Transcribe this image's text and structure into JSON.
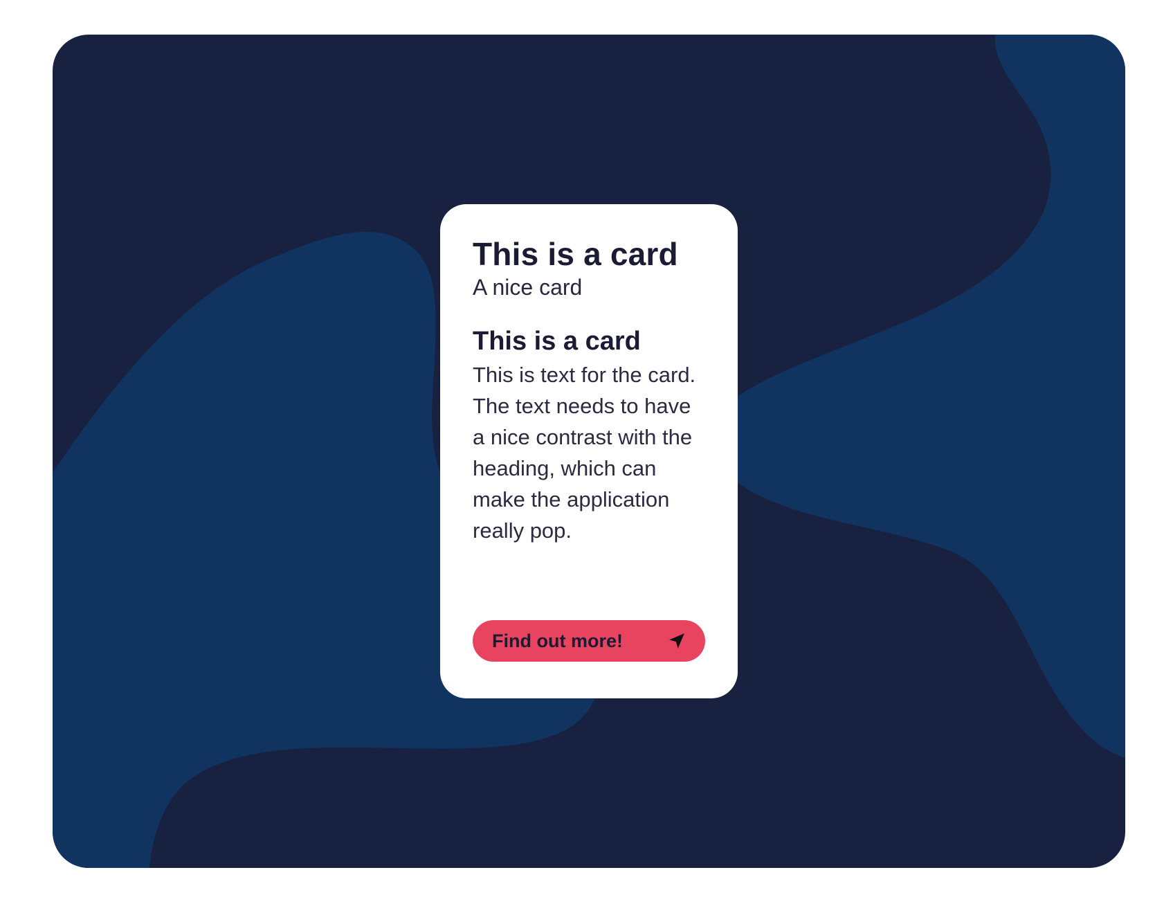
{
  "theme": {
    "background_dark": "#182240",
    "blob_color": "#10335f",
    "card_background": "#ffffff",
    "button_color": "#e84460",
    "text_color": "#1b1b34"
  },
  "card": {
    "title": "This is a card",
    "subtitle": "A nice card",
    "heading": "This is a card",
    "body": "This is text for the card. The text needs to have a nice contrast with the heading, which can make the application really pop.",
    "button": {
      "label": "Find out more!",
      "icon": "navigation-arrow-icon"
    }
  }
}
